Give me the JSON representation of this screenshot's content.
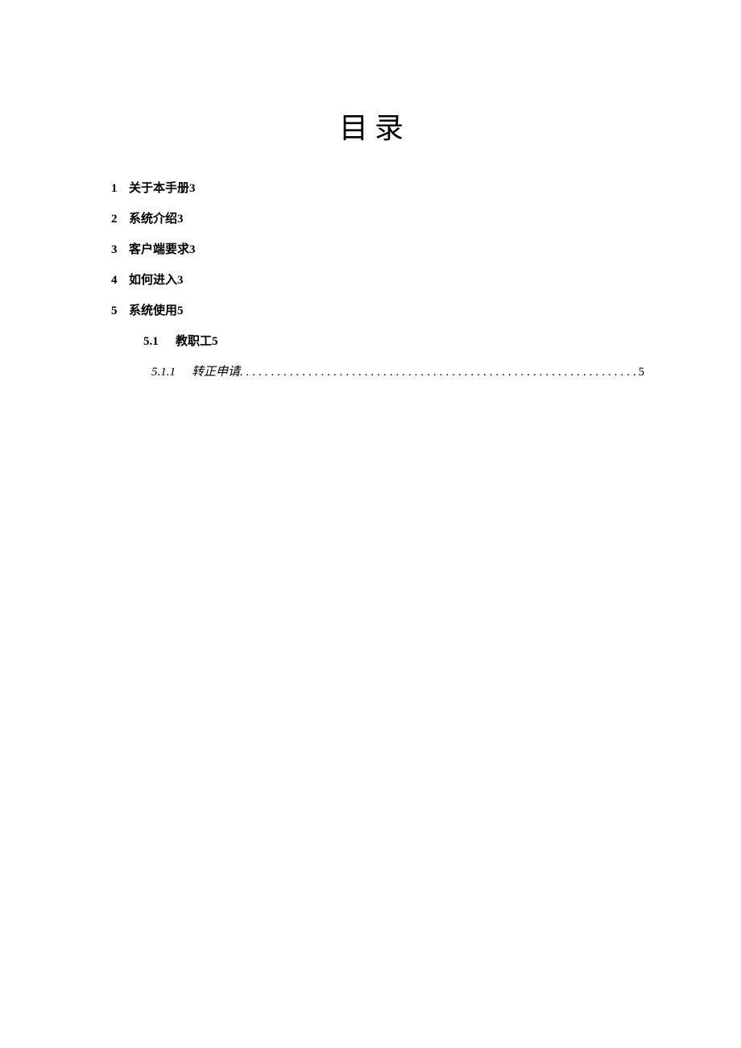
{
  "title": "目录",
  "toc": {
    "items": [
      {
        "num": "1",
        "text": "关于本手册",
        "page": "3"
      },
      {
        "num": "2",
        "text": "系统介绍",
        "page": "3"
      },
      {
        "num": "3",
        "text": "客户端要求",
        "page": "3"
      },
      {
        "num": "4",
        "text": "如何进入",
        "page": "3"
      },
      {
        "num": "5",
        "text": "系统使用",
        "page": "5"
      }
    ],
    "sub": {
      "num": "5.1",
      "text": "教职工",
      "page": "5"
    },
    "subsub": {
      "num": "5.1.1",
      "text": "转正申请.",
      "page": "5"
    }
  }
}
